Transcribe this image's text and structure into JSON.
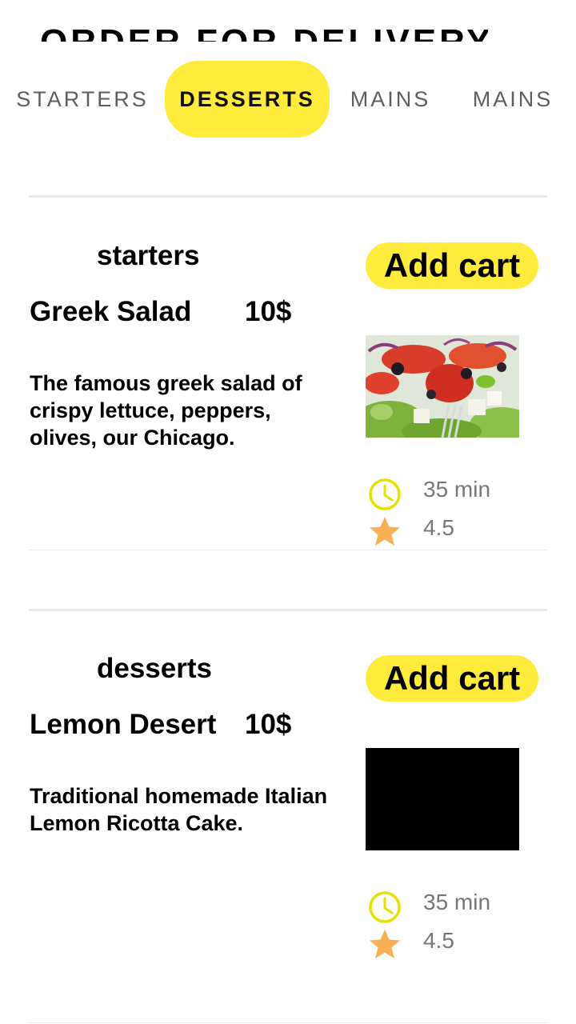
{
  "header": {
    "title": "ORDER FOR DELIVERY!"
  },
  "tabs": [
    "STARTERS",
    "DESSERTS",
    "MAINS",
    "MAINS"
  ],
  "active_tab_index": 1,
  "items": [
    {
      "category": "starters",
      "name": "Greek Salad",
      "price": "10$",
      "description": "The famous greek salad of crispy lettuce, peppers, olives, our Chicago.",
      "button": "Add cart",
      "time": "35 min",
      "rating": "4.5"
    },
    {
      "category": "desserts",
      "name": "Lemon Desert",
      "price": "10$",
      "description": "Traditional homemade Italian Lemon Ricotta Cake.",
      "button": "Add cart",
      "time": "35 min",
      "rating": "4.5"
    }
  ],
  "colors": {
    "accent": "#ffeb3b",
    "clock": "#e8e000",
    "star": "#f9b054",
    "meta_text": "#777777"
  }
}
